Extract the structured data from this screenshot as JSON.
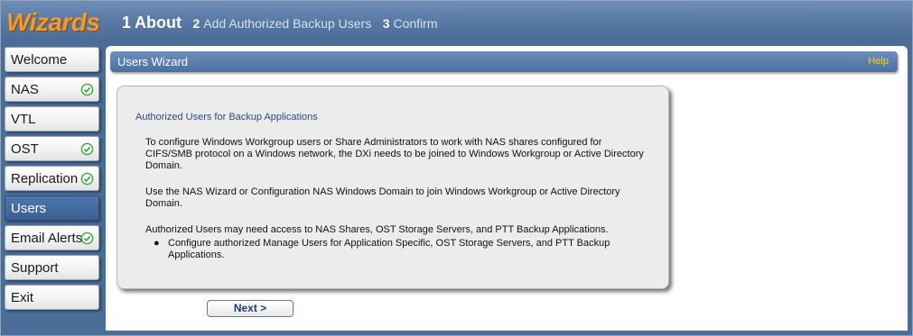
{
  "brand": "Wizards",
  "steps": [
    {
      "num": "1",
      "label": "About",
      "active": true
    },
    {
      "num": "2",
      "label": "Add Authorized Backup Users",
      "active": false
    },
    {
      "num": "3",
      "label": "Confirm",
      "active": false
    }
  ],
  "sidebar": {
    "items": [
      {
        "label": "Welcome",
        "checked": false,
        "active": false
      },
      {
        "label": "NAS",
        "checked": true,
        "active": false
      },
      {
        "label": "VTL",
        "checked": false,
        "active": false
      },
      {
        "label": "OST",
        "checked": true,
        "active": false
      },
      {
        "label": "Replication",
        "checked": true,
        "active": false
      },
      {
        "label": "Users",
        "checked": false,
        "active": true
      },
      {
        "label": "Email Alerts",
        "checked": true,
        "active": false
      },
      {
        "label": "Support",
        "checked": false,
        "active": false
      },
      {
        "label": "Exit",
        "checked": false,
        "active": false
      }
    ],
    "check_icon": "check-circle-icon"
  },
  "content": {
    "title": "Users Wizard",
    "help": "Help",
    "heading": "Authorized Users for Backup Applications",
    "paragraphs": [
      "To configure Windows Workgroup users or Share Administrators to work with NAS shares configured for CIFS/SMB protocol on a Windows network, the DXi needs to be joined to Windows Workgroup or Active Directory Domain.",
      "Use the NAS Wizard or Configuration NAS Windows Domain to join Windows Workgroup or Active Directory Domain.",
      "Authorized Users may need access to NAS Shares, OST Storage Servers, and PTT Backup Applications."
    ],
    "bullets": [
      "Configure authorized Manage Users for Application Specific, OST Storage Servers, and PTT Backup Applications."
    ],
    "next_label": "Next >"
  },
  "colors": {
    "brand": "#f29a2e",
    "header_blue": "#4a6d99",
    "active_nav": "#3b5f93",
    "help_link": "#f3d42a",
    "check_green": "#3aa63a"
  }
}
